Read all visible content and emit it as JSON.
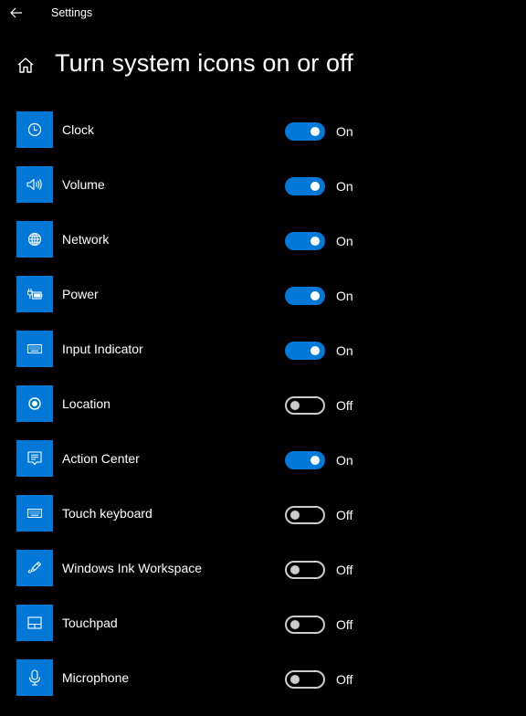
{
  "window": {
    "title": "Settings",
    "back_icon": "back-arrow-icon"
  },
  "header": {
    "home_icon": "home-icon",
    "title": "Turn system icons on or off"
  },
  "colors": {
    "accent": "#0078d7",
    "background": "#000000",
    "text": "#ffffff",
    "toggle_off": "#cccccc"
  },
  "items": [
    {
      "label": "Clock",
      "icon": "clock-icon",
      "on": true,
      "state": "On"
    },
    {
      "label": "Volume",
      "icon": "volume-icon",
      "on": true,
      "state": "On"
    },
    {
      "label": "Network",
      "icon": "network-globe-icon",
      "on": true,
      "state": "On"
    },
    {
      "label": "Power",
      "icon": "power-battery-icon",
      "on": true,
      "state": "On"
    },
    {
      "label": "Input Indicator",
      "icon": "keyboard-icon",
      "on": true,
      "state": "On"
    },
    {
      "label": "Location",
      "icon": "location-icon",
      "on": false,
      "state": "Off"
    },
    {
      "label": "Action Center",
      "icon": "action-center-icon",
      "on": true,
      "state": "On"
    },
    {
      "label": "Touch keyboard",
      "icon": "touch-keyboard-icon",
      "on": false,
      "state": "Off"
    },
    {
      "label": "Windows Ink Workspace",
      "icon": "pen-ink-icon",
      "on": false,
      "state": "Off"
    },
    {
      "label": "Touchpad",
      "icon": "touchpad-icon",
      "on": false,
      "state": "Off"
    },
    {
      "label": "Microphone",
      "icon": "microphone-icon",
      "on": false,
      "state": "Off"
    }
  ]
}
